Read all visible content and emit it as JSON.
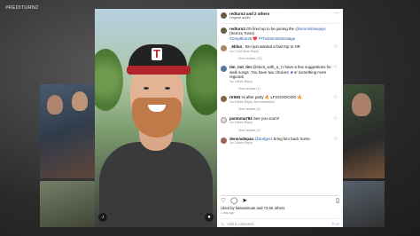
{
  "broadcast": {
    "tag": "#REDITURN2"
  },
  "post": {
    "header": {
      "author": "redturn2 and 2 others",
      "subtitle": "Original audio"
    },
    "caption": {
      "author": "redturn2",
      "text_before": "Oh fired up to be joining the ",
      "mention": "@torontobluejays",
      "text_after": " (Xemzs Torss)",
      "hashtags": "#DirtyBlue26 ❤️ #TheMorsWoEsaage"
    },
    "comments": [
      {
        "user": "_6bfan_",
        "text": "Bro just wanted a fast trip to HR",
        "meta": "1w   1,544 likes   Reply",
        "replies": "View replies (15)"
      },
      {
        "user": "tim_not_tim",
        "text_before": "@stunt_with_a_t I have a few suggestions for walk songs. You have two choices: ",
        "mention": "■",
        "text_after": " or something more regional",
        "meta": "1w   3 likes   Reply",
        "replies": "View replies (1)"
      },
      {
        "user": "rtr993",
        "text": "Hi after party 🔥 LFGOOOOOO 🔥",
        "meta": "1w   5 likes   Reply   See translation",
        "replies": "View replies (5)"
      },
      {
        "user": "pantoma784",
        "text": "See you soon!!",
        "meta": "1w   5 likes   Reply",
        "replies": "View replies (1)"
      },
      {
        "user": "dennisdepau",
        "mention": "@dodgers",
        "text": " bring him back home.",
        "meta": "1w   3 likes   Reply",
        "replies": ""
      }
    ],
    "likes": "Liked by lainamimute and 73.6K others",
    "ago": "1 day ago",
    "add_comment": {
      "placeholder": "Add a comment...",
      "post_label": "Post"
    }
  }
}
